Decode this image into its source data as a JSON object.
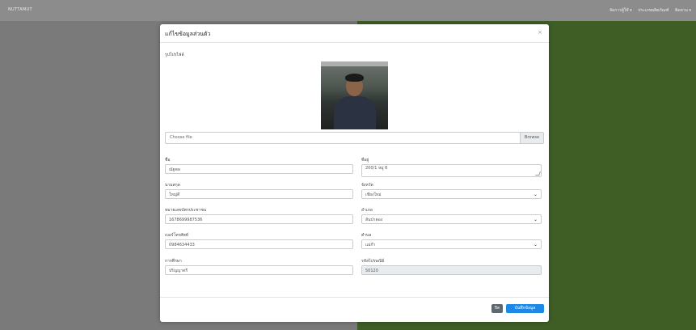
{
  "app": {
    "brand": "NUTTAMUT",
    "nav": [
      "จัดการผู้ใช้ ▾",
      "ประเภทผลิตภัณฑ์",
      "ติดตาม ▾"
    ]
  },
  "modal": {
    "title": "แก้ไขข้อมูลส่วนตัว",
    "close_icon": "×",
    "profile_label": "รูปโปรไฟล์",
    "file_placeholder": "Choose file",
    "browse_label": "Browse",
    "fields": {
      "first_name": {
        "label": "ชื่อ",
        "value": "ณัฐพล"
      },
      "last_name": {
        "label": "นามสกุล",
        "value": "ใหญ่ดี"
      },
      "id_card": {
        "label": "หมายเลขบัตรประชาชน",
        "value": "1678699987536"
      },
      "phone": {
        "label": "เบอร์โทรศัพท์",
        "value": "0984634433"
      },
      "education": {
        "label": "การศึกษา",
        "value": "ปริญญาตรี"
      },
      "address": {
        "label": "ที่อยู่",
        "value": "200/1 หมู่ 6"
      },
      "province": {
        "label": "จังหวัด",
        "value": "เชียงใหม่"
      },
      "district": {
        "label": "อำเภอ",
        "value": "สันป่าตอง"
      },
      "subdistrict": {
        "label": "ตำบล",
        "value": "แม่ก๊า"
      },
      "postal": {
        "label": "รหัสไปรษณีย์",
        "value": "50120"
      }
    },
    "footer": {
      "close_label": "ปิด",
      "save_label": "บันทึกข้อมูล"
    }
  }
}
